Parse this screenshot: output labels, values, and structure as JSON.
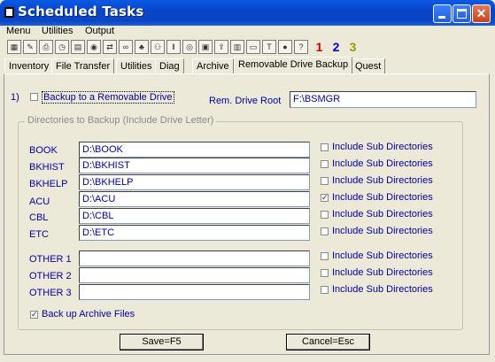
{
  "window": {
    "title": "Scheduled Tasks"
  },
  "menu": [
    "Menu",
    "Utilities",
    "Output"
  ],
  "toolbar": {
    "icons": [
      "calculator",
      "notepad",
      "printer",
      "clock",
      "calendar",
      "dial",
      "transfer",
      "binoculars",
      "tree",
      "network",
      "barcode",
      "target",
      "lock",
      "export",
      "chart",
      "monitor",
      "tro",
      "help-circle",
      "question"
    ],
    "number_buttons": [
      "1",
      "2",
      "3"
    ],
    "colors": {
      "one": "#cc0000",
      "two": "#0000cc",
      "three": "#999900"
    }
  },
  "tabs": [
    "Inventory",
    "File Transfer",
    "Utilities",
    "Diag",
    "Archive",
    "Removable Drive Backup",
    "Quest"
  ],
  "backup": {
    "number": "1)",
    "enable_label": "Backup to a Removable Drive",
    "enable_checked": false,
    "root_label": "Rem. Drive Root",
    "root_value": "F:\\BSMGR"
  },
  "directories": {
    "legend": "Directories to Backup (Include Drive Letter)",
    "rows": [
      {
        "label": "BOOK",
        "path": "D:\\BOOK",
        "sub_label": "Include Sub Directories",
        "sub_checked": false
      },
      {
        "label": "BKHIST",
        "path": "D:\\BKHIST",
        "sub_label": "Include Sub Directories",
        "sub_checked": false
      },
      {
        "label": "BKHELP",
        "path": "D:\\BKHELP",
        "sub_label": "Include Sub Directories",
        "sub_checked": false
      },
      {
        "label": "ACU",
        "path": "D:\\ACU",
        "sub_label": "Include Sub Directories",
        "sub_checked": true
      },
      {
        "label": "CBL",
        "path": "D:\\CBL",
        "sub_label": "Include Sub Directories",
        "sub_checked": false
      },
      {
        "label": "ETC",
        "path": "D:\\ETC",
        "sub_label": "Include Sub Directories",
        "sub_checked": false
      }
    ],
    "others": [
      {
        "label": "OTHER 1",
        "path": "",
        "sub_label": "Include Sub Directories",
        "sub_checked": false
      },
      {
        "label": "OTHER 2",
        "path": "",
        "sub_label": "Include Sub Directories",
        "sub_checked": false
      },
      {
        "label": "OTHER 3",
        "path": "",
        "sub_label": "Include Sub Directories",
        "sub_checked": false
      }
    ],
    "archive_label": "Back up Archive Files",
    "archive_checked": true
  },
  "buttons": {
    "save": "Save=F5",
    "cancel": "Cancel=Esc"
  }
}
